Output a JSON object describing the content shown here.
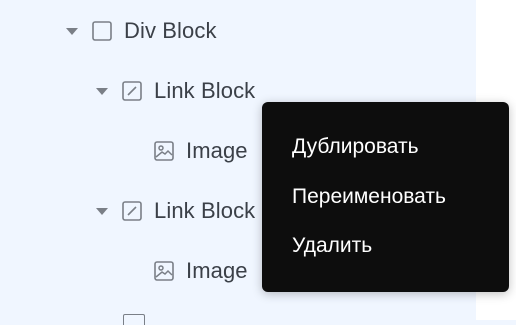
{
  "navigator": {
    "items": [
      {
        "label": "Div Block",
        "icon": "div-block-icon",
        "expanded": true
      },
      {
        "label": "Link Block",
        "icon": "link-block-icon",
        "expanded": true
      },
      {
        "label": "Image",
        "icon": "image-icon"
      },
      {
        "label": "Link Block",
        "icon": "link-block-icon",
        "expanded": true
      },
      {
        "label": "Image",
        "icon": "image-icon"
      }
    ]
  },
  "context_menu": {
    "items": [
      "Дублировать",
      "Переименовать",
      "Удалить"
    ]
  },
  "colors": {
    "panel_bg": "#f0f6ff",
    "menu_bg": "#0d0d0d",
    "text": "#3b4048",
    "icon": "#7a7f87"
  }
}
